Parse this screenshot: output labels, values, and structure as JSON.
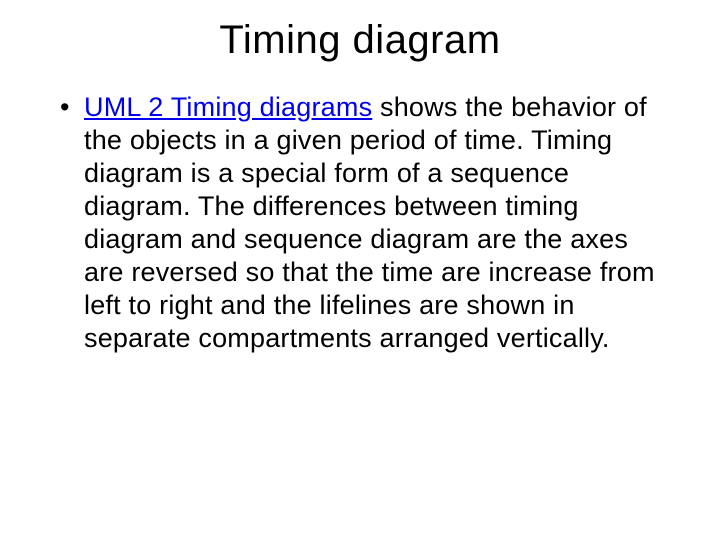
{
  "slide": {
    "title": "Timing diagram",
    "bullet": {
      "link_text": "UML 2 Timing diagrams",
      "rest_text": " shows the behavior of the objects in a given period of time. Timing diagram is a special form of a sequence diagram. The differences between timing diagram and sequence diagram are the axes are reversed so that the time are increase from left to right and the lifelines are shown in separate compartments arranged vertically."
    }
  }
}
